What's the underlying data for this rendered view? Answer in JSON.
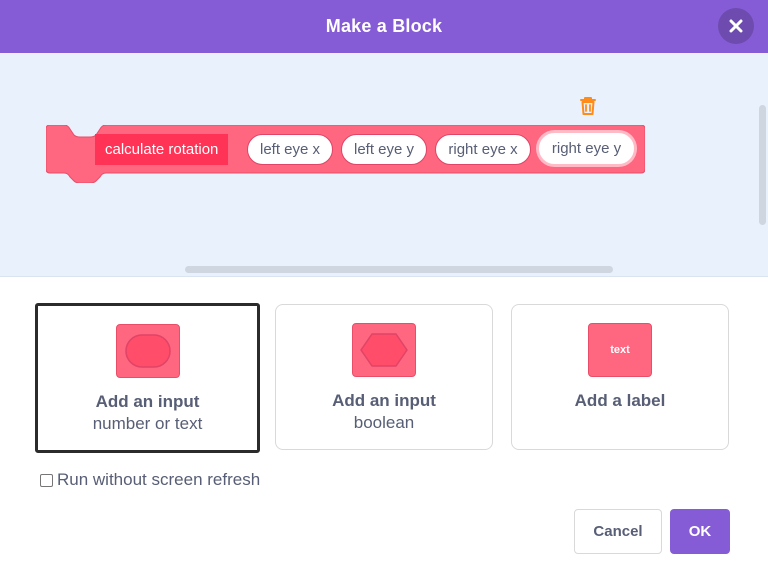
{
  "dialog": {
    "title": "Make a Block",
    "close_icon": "close-x-icon"
  },
  "block": {
    "label": "calculate rotation",
    "color": "#ff6680",
    "label_bg": "#ff3355",
    "args": [
      {
        "label": "left eye x"
      },
      {
        "label": "left eye y"
      },
      {
        "label": "right eye x"
      },
      {
        "label": "right eye y",
        "selected": true
      }
    ],
    "delete_icon": "trash-icon"
  },
  "options": [
    {
      "title": "Add an input",
      "subtitle": "number or text",
      "icon": "round-input-icon",
      "active": true
    },
    {
      "title": "Add an input",
      "subtitle": "boolean",
      "icon": "hexagon-input-icon",
      "active": false
    },
    {
      "title": "Add a label",
      "subtitle": "",
      "icon": "text-label-icon",
      "icon_text": "text",
      "active": false
    }
  ],
  "run_without_refresh": {
    "label": "Run without screen refresh",
    "checked": false
  },
  "buttons": {
    "cancel": "Cancel",
    "ok": "OK"
  },
  "colors": {
    "accent": "#855cd6",
    "workspace_bg": "#e9f1fc",
    "text": "#575e75",
    "block_pink": "#ff6680",
    "warning_orange": "#ff8c1a"
  }
}
